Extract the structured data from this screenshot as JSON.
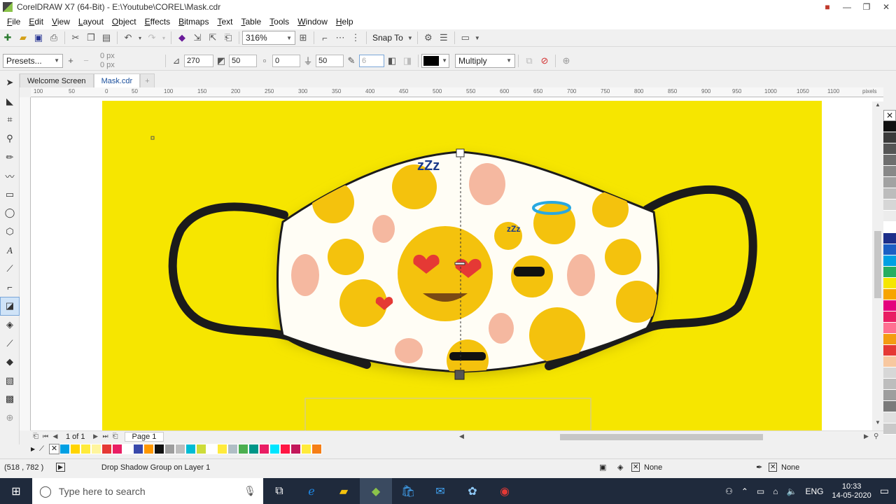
{
  "window": {
    "title": "CorelDRAW X7 (64-Bit) - E:\\Youtube\\COREL\\Mask.cdr"
  },
  "menu": [
    "File",
    "Edit",
    "View",
    "Layout",
    "Object",
    "Effects",
    "Bitmaps",
    "Text",
    "Table",
    "Tools",
    "Window",
    "Help"
  ],
  "standard_toolbar": {
    "zoom": "316%",
    "snap_to": "Snap To"
  },
  "property_bar": {
    "presets": "Presets...",
    "offset_x": "0 px",
    "offset_y": "0 px",
    "shadow_angle": "270",
    "shadow_opacity": "50",
    "shadow_stretch": "0",
    "shadow_feather": "50",
    "feather_value": "6",
    "shadow_color": "#000000",
    "merge_mode": "Multiply"
  },
  "tabs": [
    {
      "label": "Welcome Screen",
      "active": false
    },
    {
      "label": "Mask.cdr",
      "active": true
    }
  ],
  "ruler_ticks": [
    "100",
    "50",
    "0",
    "50",
    "100",
    "150",
    "200",
    "250",
    "300",
    "350",
    "400",
    "450",
    "500",
    "550",
    "600",
    "650",
    "700",
    "750",
    "800",
    "850",
    "900",
    "950",
    "1000",
    "1050",
    "1100"
  ],
  "ruler_unit": "pixels",
  "page_nav": {
    "counter": "1 of 1",
    "page_tab": "Page 1"
  },
  "status": {
    "coords": "(518 , 782 )",
    "message": "Drop Shadow Group on Layer 1",
    "fill": "None",
    "outline": "None"
  },
  "taskbar": {
    "search_placeholder": "Type here to search",
    "language": "ENG",
    "time": "10:33",
    "date": "14-05-2020"
  },
  "colors": {
    "page": "#f6e600",
    "palette": [
      "#111111",
      "#3a3a3a",
      "#555555",
      "#6e6e6e",
      "#888888",
      "#a2a2a2",
      "#bcbcbc",
      "#d6d6d6",
      "#ececec",
      "#ffffff",
      "#1d2f8a",
      "#1b5fc4",
      "#00a0e3",
      "#27ae60",
      "#f5e600",
      "#f7a400",
      "#e4007c",
      "#e91e63",
      "#ff6f91",
      "#f39c12",
      "#e53935",
      "#f8c8a0",
      "#d7d7d7",
      "#bdbdbd",
      "#9e9e9e",
      "#7a7a7a",
      "#e0e0e0",
      "#c9c9c9"
    ],
    "doc_palette": [
      "#00a0e3",
      "#ffd400",
      "#ffeb3b",
      "#fff59d",
      "#e53935",
      "#e91e63",
      "#ffffff",
      "#3949ab",
      "#ff9800",
      "#111111",
      "#9e9e9e",
      "#bdbdbd",
      "#00bcd4",
      "#cddc39",
      "#ffffff",
      "#ffeb3b",
      "#b0bec5",
      "#4caf50",
      "#009688",
      "#e91e63",
      "#00e5ff",
      "#ff1744",
      "#c2185b",
      "#ffeb3b",
      "#f57f17"
    ]
  }
}
